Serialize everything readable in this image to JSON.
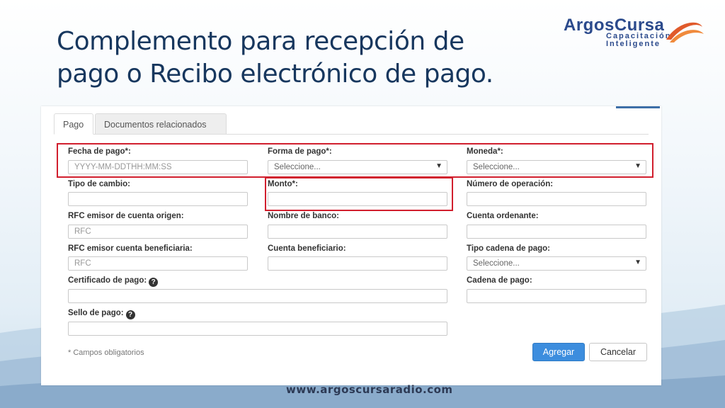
{
  "slide": {
    "title_line1": "Complemento para recepción de",
    "title_line2": "pago o Recibo electrónico de pago.",
    "footer_url": "www.argoscursaradio.com"
  },
  "logo": {
    "name": "ArgosCursa",
    "tagline_line1": "Capacitación",
    "tagline_line2": "Inteligente",
    "icon": "swirl-logo-icon"
  },
  "tabs": [
    {
      "label": "Pago",
      "active": true
    },
    {
      "label": "Documentos relacionados",
      "active": false
    }
  ],
  "form": {
    "fecha_pago": {
      "label": "Fecha de pago*:",
      "placeholder": "YYYY-MM-DDTHH:MM:SS"
    },
    "forma_pago": {
      "label": "Forma de pago*:",
      "value": "Seleccione..."
    },
    "moneda": {
      "label": "Moneda*:",
      "value": "Seleccione..."
    },
    "tipo_cambio": {
      "label": "Tipo de cambio:",
      "value": ""
    },
    "monto": {
      "label": "Monto*:",
      "value": ""
    },
    "numero_operacion": {
      "label": "Número de operación:",
      "value": ""
    },
    "rfc_origen": {
      "label": "RFC emisor de cuenta origen:",
      "placeholder": "RFC"
    },
    "nombre_banco": {
      "label": "Nombre de banco:",
      "value": ""
    },
    "cuenta_ordenante": {
      "label": "Cuenta ordenante:",
      "value": ""
    },
    "rfc_beneficiaria": {
      "label": "RFC emisor cuenta beneficiaria:",
      "placeholder": "RFC"
    },
    "cuenta_beneficiario": {
      "label": "Cuenta beneficiario:",
      "value": ""
    },
    "tipo_cadena": {
      "label": "Tipo cadena de pago:",
      "value": "Seleccione..."
    },
    "certificado": {
      "label": "Certificado de pago:",
      "value": ""
    },
    "cadena": {
      "label": "Cadena de pago:",
      "value": ""
    },
    "sello": {
      "label": "Sello de pago:",
      "value": ""
    },
    "help_glyph": "?",
    "caret_glyph": "▼",
    "required_note": "* Campos obligatorios",
    "submit_label": "Agregar",
    "cancel_label": "Cancelar"
  },
  "colors": {
    "title": "#17375e",
    "primary_button": "#3c8dde",
    "highlight_box": "#d11f2e"
  }
}
